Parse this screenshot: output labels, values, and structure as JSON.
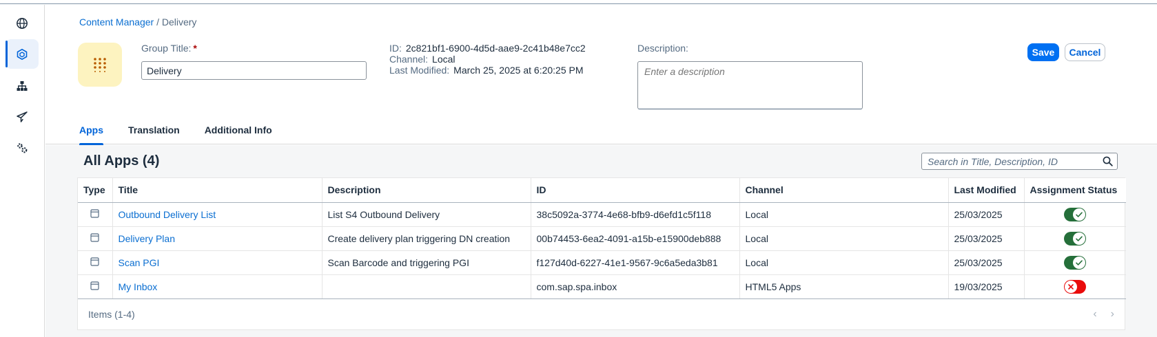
{
  "breadcrumb": {
    "link": "Content Manager",
    "current": "/ Delivery"
  },
  "group": {
    "title_label": "Group Title:",
    "required_mark": "*",
    "title_value": "Delivery"
  },
  "meta": {
    "id_label": "ID:",
    "id_value": "2c821bf1-6900-4d5d-aae9-2c41b48e7cc2",
    "channel_label": "Channel:",
    "channel_value": "Local",
    "modified_label": "Last Modified:",
    "modified_value": "March 25, 2025 at 6:20:25 PM"
  },
  "description": {
    "label": "Description:",
    "placeholder": "Enter a description"
  },
  "actions": {
    "save": "Save",
    "cancel": "Cancel"
  },
  "tabs": [
    {
      "label": "Apps",
      "active": true
    },
    {
      "label": "Translation",
      "active": false
    },
    {
      "label": "Additional Info",
      "active": false
    }
  ],
  "apps": {
    "title": "All Apps (4)",
    "search_placeholder": "Search in Title, Description, ID",
    "columns": [
      "Type",
      "Title",
      "Description",
      "ID",
      "Channel",
      "Last Modified",
      "Assignment Status"
    ],
    "rows": [
      {
        "title": "Outbound Delivery List",
        "description": "List S4 Outbound Delivery",
        "id": "38c5092a-3774-4e68-bfb9-d6efd1c5f118",
        "channel": "Local",
        "modified": "25/03/2025",
        "assigned": true
      },
      {
        "title": "Delivery Plan",
        "description": "Create delivery plan triggering DN creation",
        "id": "00b74453-6ea2-4091-a15b-e15900deb888",
        "channel": "Local",
        "modified": "25/03/2025",
        "assigned": true
      },
      {
        "title": "Scan PGI",
        "description": "Scan Barcode and triggering PGI",
        "id": "f127d40d-6227-41e1-9567-9c6a5eda3b81",
        "channel": "Local",
        "modified": "25/03/2025",
        "assigned": true
      },
      {
        "title": "My Inbox",
        "description": "",
        "id": "com.sap.spa.inbox",
        "channel": "HTML5 Apps",
        "modified": "19/03/2025",
        "assigned": false
      }
    ],
    "footer": "Items (1-4)"
  },
  "colors": {
    "accent": "#0064d9",
    "save_bg": "#0070f2",
    "assigned": "#256f3a",
    "unassigned": "#e90b0b",
    "tile_bg": "#fdf3c0",
    "tile_dots": "#b85c00"
  },
  "icons": {
    "nav": [
      "globe-icon",
      "content-cube-icon",
      "hierarchy-icon",
      "paper-plane-icon",
      "settings-gears-icon"
    ],
    "tile": "app-grid-icon",
    "search": "search-icon",
    "row_type": "app-window-icon",
    "assigned": "checkmark-icon",
    "unassigned": "close-icon",
    "pager": [
      "chevron-left-icon",
      "chevron-right-icon"
    ]
  }
}
